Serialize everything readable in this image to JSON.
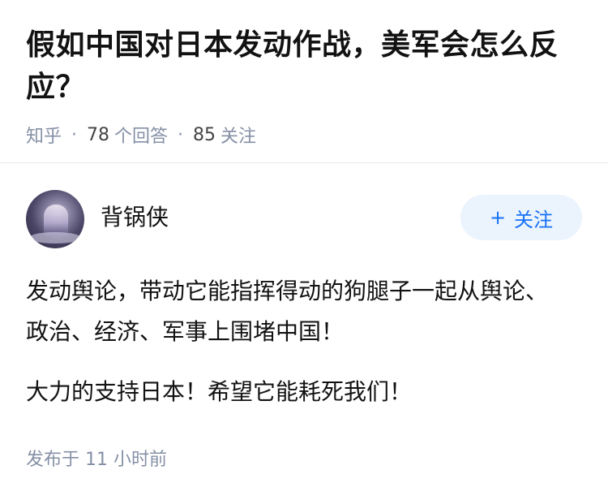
{
  "question": {
    "title": "假如中国对日本发动作战，美军会怎么反应？",
    "source": "知乎",
    "answer_count": "78",
    "answer_label": "个回答",
    "follow_count": "85",
    "follow_label": "关注"
  },
  "author": {
    "name": "背锅侠",
    "follow_button": "关注",
    "follow_icon": "+"
  },
  "answer": {
    "paragraphs": [
      "发动舆论，带动它能指挥得动的狗腿子一起从舆论、政治、经济、军事上围堵中国！",
      "大力的支持日本！希望它能耗死我们！"
    ]
  },
  "footer": {
    "posted_label": "发布于",
    "posted_time": "11 小时前"
  },
  "colors": {
    "accent": "#1772f6",
    "button_bg": "#ebf3fd",
    "meta": "#8590a6"
  }
}
